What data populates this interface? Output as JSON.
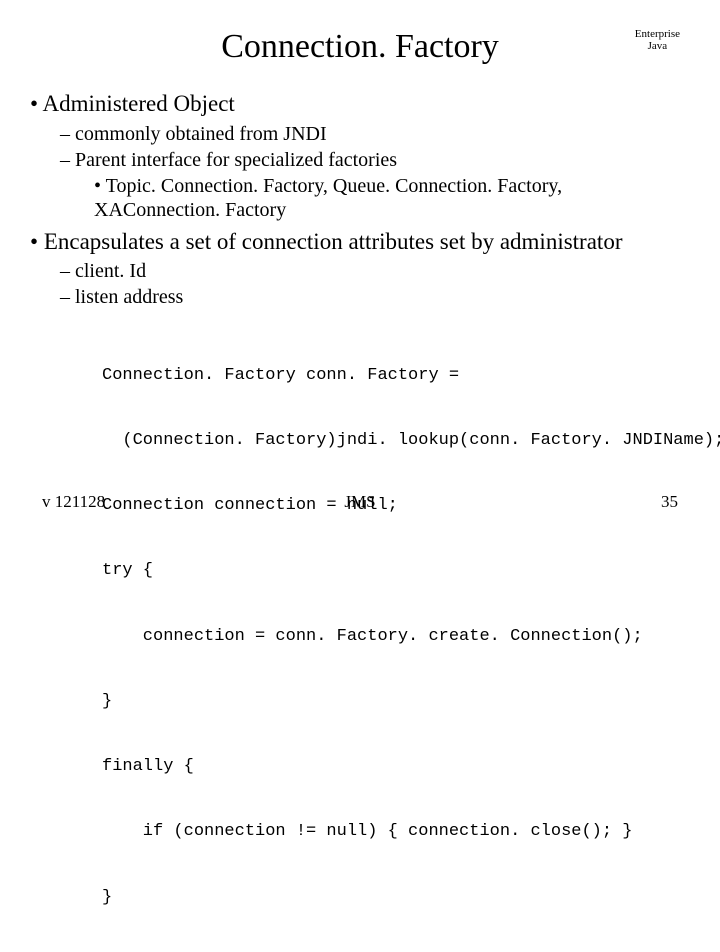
{
  "corner": {
    "line1": "Enterprise",
    "line2": "Java"
  },
  "title": "Connection. Factory",
  "bullets": {
    "b1a": "Administered Object",
    "b2a": "commonly obtained from JNDI",
    "b2b": "Parent interface for specialized factories",
    "b3a": "Topic. Connection. Factory, Queue. Connection. Factory, XAConnection. Factory",
    "b1b": "Encapsulates a set of connection attributes set by administrator",
    "b2c": "client. Id",
    "b2d": "listen address"
  },
  "code": {
    "l1": "Connection. Factory conn. Factory =",
    "l2": "  (Connection. Factory)jndi. lookup(conn. Factory. JNDIName);",
    "l3": "Connection connection = null;",
    "l4": "try {",
    "l5": "    connection = conn. Factory. create. Connection();",
    "l6": "}",
    "l7": "finally {",
    "l8": "    if (connection != null) { connection. close(); }",
    "l9": "}"
  },
  "footer": {
    "left": "v 121128",
    "center": "JMS",
    "right": "35"
  }
}
